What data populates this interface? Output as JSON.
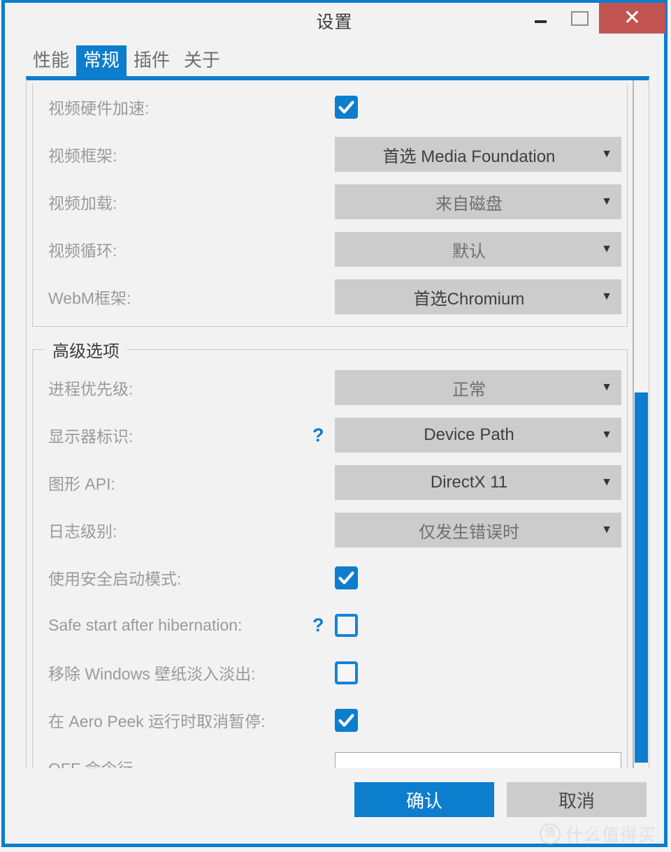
{
  "window": {
    "title": "设置",
    "minimize_label": "—",
    "maximize_label": "□",
    "close_label": "✕",
    "accent_color": "#0d7dcd",
    "close_color": "#c25450"
  },
  "tabs": [
    {
      "label": "性能",
      "active": false
    },
    {
      "label": "常规",
      "active": true
    },
    {
      "label": "插件",
      "active": false
    },
    {
      "label": "关于",
      "active": false
    }
  ],
  "groups": [
    {
      "title": "",
      "rows": [
        {
          "label": "视频硬件加速:",
          "control": "checkbox",
          "checked": true,
          "help": false
        },
        {
          "label": "视频框架:",
          "control": "combo",
          "value": "首选 Media Foundation",
          "help": false
        },
        {
          "label": "视频加载:",
          "control": "combo",
          "value": "来自磁盘",
          "help": false
        },
        {
          "label": "视频循环:",
          "control": "combo",
          "value": "默认",
          "help": false
        },
        {
          "label": "WebM框架:",
          "control": "combo",
          "value": "首选Chromium",
          "help": false
        }
      ]
    },
    {
      "title": "高级选项",
      "rows": [
        {
          "label": "进程优先级:",
          "control": "combo",
          "value": "正常",
          "help": false
        },
        {
          "label": "显示器标识:",
          "control": "combo",
          "value": "Device Path",
          "help": true
        },
        {
          "label": "图形 API:",
          "control": "combo",
          "value": "DirectX 11",
          "help": false
        },
        {
          "label": "日志级别:",
          "control": "combo",
          "value": "仅发生错误时",
          "help": false
        },
        {
          "label": "使用安全启动模式:",
          "control": "checkbox",
          "checked": true,
          "help": false
        },
        {
          "label": "Safe start after hibernation:",
          "control": "checkbox",
          "checked": false,
          "help": true
        },
        {
          "label": "移除 Windows 壁纸淡入淡出:",
          "control": "checkbox",
          "checked": false,
          "help": false
        },
        {
          "label": "在 Aero Peek 运行时取消暂停:",
          "control": "checkbox",
          "checked": true,
          "help": false
        },
        {
          "label": "OFF 命令行",
          "control": "textbox",
          "value": "",
          "help": false
        }
      ]
    }
  ],
  "help_icon_label": "?",
  "combo_arrow_label": "▼",
  "scrollbar": {
    "name": "vertical-scrollbar"
  },
  "footer": {
    "ok_label": "确认",
    "cancel_label": "取消"
  },
  "watermark": {
    "badge": "值",
    "text": "什么值得买"
  }
}
